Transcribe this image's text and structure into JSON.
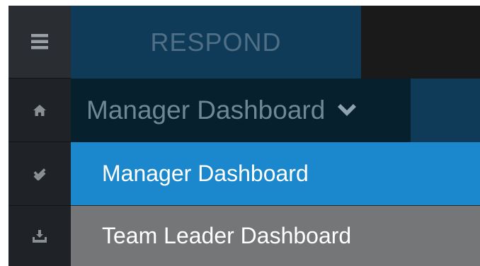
{
  "header": {
    "brand": "RESPOND"
  },
  "rail": {
    "icons": [
      "menu-icon",
      "home-icon",
      "double-check-icon",
      "download-tray-icon"
    ]
  },
  "dashboard_selector": {
    "current": "Manager Dashboard",
    "options": [
      {
        "label": "Manager Dashboard",
        "selected": true
      },
      {
        "label": "Team Leader Dashboard",
        "selected": false
      }
    ]
  },
  "colors": {
    "rail_bg": "#1f2226",
    "brand_bg": "#0f3b58",
    "selector_bg": "#06202e",
    "selected_option_bg": "#1b87cc",
    "option_bg": "#757677"
  }
}
